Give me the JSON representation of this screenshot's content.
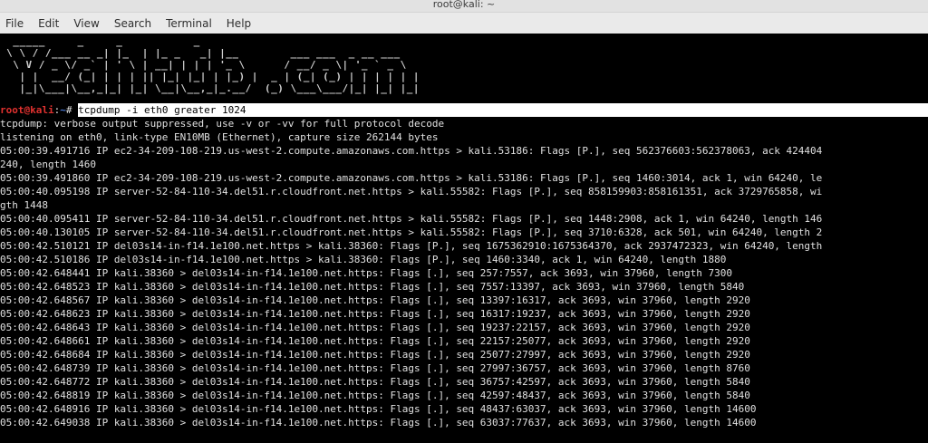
{
  "window": {
    "title": "root@kali: ~"
  },
  "menu": [
    "File",
    "Edit",
    "View",
    "Search",
    "Terminal",
    "Help"
  ],
  "banner": [
    "  _____     _     _           _",
    " \\ \\ / /___ __ _| |_  | |_ _   _| |__        ___ ___  _ __ ___",
    "  \\ V / _ \\/ _` | ' \\ | __| | | | '_ \\      / __/ _ \\| '_ ` _ \\",
    "   | |  __/ (_| | | | || |_| |_| | |_) |  _ | (_| (_) | | | | | |",
    "   |_|\\___|\\__,_|_| |_| \\__|\\__,_|_.__/  (_) \\___\\___/|_| |_| |_|"
  ],
  "prompt": {
    "user": "root@kali",
    "sep": ":",
    "path": "~",
    "char": "# ",
    "command": "tcpdump -i eth0 greater 1024"
  },
  "output": [
    "tcpdump: verbose output suppressed, use -v or -vv for full protocol decode",
    "listening on eth0, link-type EN10MB (Ethernet), capture size 262144 bytes",
    "05:00:39.491716 IP ec2-34-209-108-219.us-west-2.compute.amazonaws.com.https > kali.53186: Flags [P.], seq 562376603:562378063, ack 424404",
    "240, length 1460",
    "05:00:39.491860 IP ec2-34-209-108-219.us-west-2.compute.amazonaws.com.https > kali.53186: Flags [P.], seq 1460:3014, ack 1, win 64240, le",
    "05:00:40.095198 IP server-52-84-110-34.del51.r.cloudfront.net.https > kali.55582: Flags [P.], seq 858159903:858161351, ack 3729765858, wi",
    "gth 1448",
    "05:00:40.095411 IP server-52-84-110-34.del51.r.cloudfront.net.https > kali.55582: Flags [P.], seq 1448:2908, ack 1, win 64240, length 146",
    "05:00:40.130105 IP server-52-84-110-34.del51.r.cloudfront.net.https > kali.55582: Flags [P.], seq 3710:6328, ack 501, win 64240, length 2",
    "05:00:42.510121 IP del03s14-in-f14.1e100.net.https > kali.38360: Flags [P.], seq 1675362910:1675364370, ack 2937472323, win 64240, length",
    "05:00:42.510186 IP del03s14-in-f14.1e100.net.https > kali.38360: Flags [P.], seq 1460:3340, ack 1, win 64240, length 1880",
    "05:00:42.648441 IP kali.38360 > del03s14-in-f14.1e100.net.https: Flags [.], seq 257:7557, ack 3693, win 37960, length 7300",
    "05:00:42.648523 IP kali.38360 > del03s14-in-f14.1e100.net.https: Flags [.], seq 7557:13397, ack 3693, win 37960, length 5840",
    "05:00:42.648567 IP kali.38360 > del03s14-in-f14.1e100.net.https: Flags [.], seq 13397:16317, ack 3693, win 37960, length 2920",
    "05:00:42.648623 IP kali.38360 > del03s14-in-f14.1e100.net.https: Flags [.], seq 16317:19237, ack 3693, win 37960, length 2920",
    "05:00:42.648643 IP kali.38360 > del03s14-in-f14.1e100.net.https: Flags [.], seq 19237:22157, ack 3693, win 37960, length 2920",
    "05:00:42.648661 IP kali.38360 > del03s14-in-f14.1e100.net.https: Flags [.], seq 22157:25077, ack 3693, win 37960, length 2920",
    "05:00:42.648684 IP kali.38360 > del03s14-in-f14.1e100.net.https: Flags [.], seq 25077:27997, ack 3693, win 37960, length 2920",
    "05:00:42.648739 IP kali.38360 > del03s14-in-f14.1e100.net.https: Flags [.], seq 27997:36757, ack 3693, win 37960, length 8760",
    "05:00:42.648772 IP kali.38360 > del03s14-in-f14.1e100.net.https: Flags [.], seq 36757:42597, ack 3693, win 37960, length 5840",
    "05:00:42.648819 IP kali.38360 > del03s14-in-f14.1e100.net.https: Flags [.], seq 42597:48437, ack 3693, win 37960, length 5840",
    "05:00:42.648916 IP kali.38360 > del03s14-in-f14.1e100.net.https: Flags [.], seq 48437:63037, ack 3693, win 37960, length 14600",
    "05:00:42.649038 IP kali.38360 > del03s14-in-f14.1e100.net.https: Flags [.], seq 63037:77637, ack 3693, win 37960, length 14600"
  ]
}
